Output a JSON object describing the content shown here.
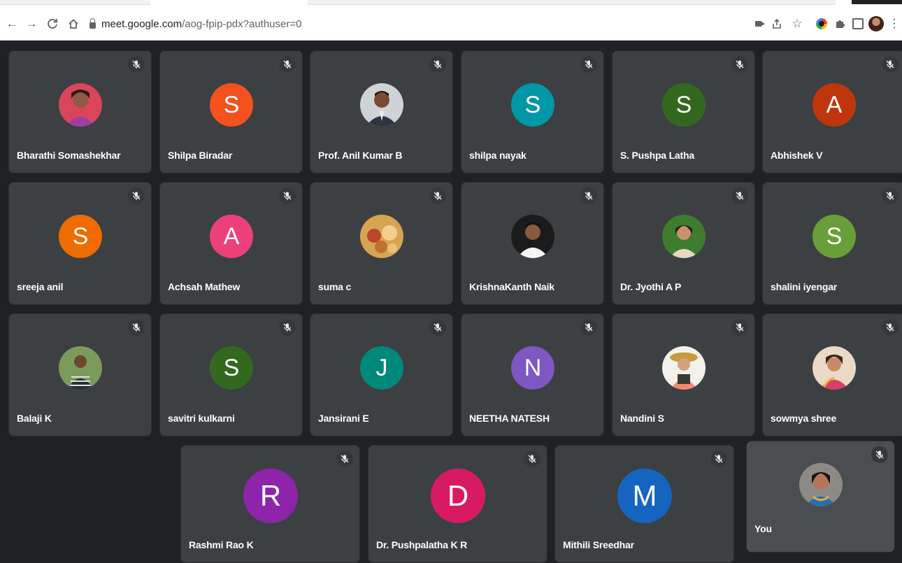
{
  "browser": {
    "url_host": "meet.google.com",
    "url_path": "/aog-fpip-pdx?authuser=0",
    "icons": [
      "back-icon",
      "forward-icon",
      "reload-icon",
      "home-icon",
      "lock-icon",
      "camera-icon",
      "share-icon",
      "star-icon",
      "extension-icon",
      "puzzle-icon",
      "sidepanel-icon",
      "profile-icon",
      "menu-icon"
    ]
  },
  "colors": {
    "meet_background": "#202124",
    "tile_background": "#3c4043"
  },
  "participants": [
    {
      "name": "Bharathi Somashekhar",
      "type": "photo",
      "muted": true
    },
    {
      "name": "Shilpa Biradar",
      "initial": "S",
      "color": "#f4511e",
      "muted": true
    },
    {
      "name": "Prof. Anil Kumar B",
      "type": "photo",
      "muted": true
    },
    {
      "name": "shilpa nayak",
      "initial": "S",
      "color": "#0097a7",
      "muted": true
    },
    {
      "name": "S. Pushpa Latha",
      "initial": "S",
      "color": "#33691e",
      "muted": true
    },
    {
      "name": "Abhishek V",
      "initial": "A",
      "color": "#bf360c",
      "muted": true
    },
    {
      "name": "sreeja anil",
      "initial": "S",
      "color": "#ef6c00",
      "muted": true
    },
    {
      "name": "Achsah Mathew",
      "initial": "A",
      "color": "#ec407a",
      "muted": true
    },
    {
      "name": "suma c",
      "type": "photo",
      "muted": true
    },
    {
      "name": "KrishnaKanth Naik",
      "type": "photo",
      "muted": true
    },
    {
      "name": "Dr. Jyothi A P",
      "type": "photo",
      "muted": true
    },
    {
      "name": "shalini iyengar",
      "initial": "S",
      "color": "#689f38",
      "muted": true
    },
    {
      "name": "Balaji K",
      "type": "photo",
      "muted": true
    },
    {
      "name": "savitri kulkarni",
      "initial": "S",
      "color": "#33691e",
      "muted": true
    },
    {
      "name": "Jansirani E",
      "initial": "J",
      "color": "#00897b",
      "muted": true
    },
    {
      "name": "NEETHA NATESH",
      "initial": "N",
      "color": "#7e57c2",
      "muted": true
    },
    {
      "name": "Nandini S",
      "type": "photo",
      "muted": true
    },
    {
      "name": "sowmya shree",
      "type": "photo",
      "muted": true
    },
    {
      "name": "Rashmi Rao K",
      "initial": "R",
      "color": "#8e24aa",
      "muted": true
    },
    {
      "name": "Dr. Pushpalatha K R",
      "initial": "D",
      "color": "#d81b60",
      "muted": true
    },
    {
      "name": "Mithili Sreedhar",
      "initial": "M",
      "color": "#1565c0",
      "muted": true
    },
    {
      "name": "You",
      "type": "photo",
      "muted": true,
      "self": true
    }
  ]
}
